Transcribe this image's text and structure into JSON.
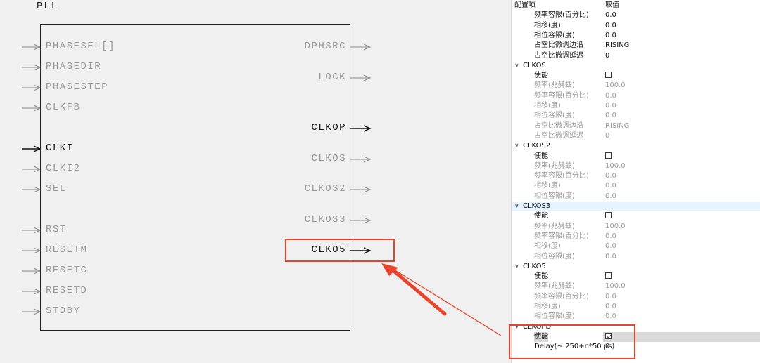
{
  "schematic": {
    "title": "PLL",
    "inputs": [
      {
        "label": "PHASESEL[]",
        "active": false
      },
      {
        "label": "PHASEDIR",
        "active": false
      },
      {
        "label": "PHASESTEP",
        "active": false
      },
      {
        "label": "CLKFB",
        "active": false
      },
      {
        "label": "CLKI",
        "active": true
      },
      {
        "label": "CLKI2",
        "active": false
      },
      {
        "label": "SEL",
        "active": false
      },
      {
        "label": "RST",
        "active": false
      },
      {
        "label": "RESETM",
        "active": false
      },
      {
        "label": "RESETC",
        "active": false
      },
      {
        "label": "RESETD",
        "active": false
      },
      {
        "label": "STDBY",
        "active": false
      }
    ],
    "outputs": [
      {
        "label": "DPHSRC",
        "active": false
      },
      {
        "label": "LOCK",
        "active": false
      },
      {
        "label": "CLKOP",
        "active": true
      },
      {
        "label": "CLKOS",
        "active": false
      },
      {
        "label": "CLKOS2",
        "active": false
      },
      {
        "label": "CLKOS3",
        "active": false
      },
      {
        "label": "CLKO5",
        "active": true
      }
    ],
    "highlight_color": "#e8442b"
  },
  "panel": {
    "header": {
      "key": "配置项",
      "value": "取值"
    },
    "top_rows": [
      {
        "key": "频率容限(百分比)",
        "value": "0.0"
      },
      {
        "key": "相移(度)",
        "value": "0.0"
      },
      {
        "key": "相位容限(度)",
        "value": "0.0"
      },
      {
        "key": "占空比微调边沿",
        "value": "RISING"
      },
      {
        "key": "占空比微调延迟",
        "value": "0"
      }
    ],
    "groups": [
      {
        "name": "CLKOS",
        "rows": [
          {
            "key": "使能",
            "checkbox": true,
            "checked": false
          },
          {
            "key": "频率(兆赫兹)",
            "value": "100.0"
          },
          {
            "key": "频率容限(百分比)",
            "value": "0.0"
          },
          {
            "key": "相移(度)",
            "value": "0.0"
          },
          {
            "key": "相位容限(度)",
            "value": "0.0"
          },
          {
            "key": "占空比微调边沿",
            "value": "RISING"
          },
          {
            "key": "占空比微调延迟",
            "value": "0"
          }
        ]
      },
      {
        "name": "CLKOS2",
        "rows": [
          {
            "key": "使能",
            "checkbox": true,
            "checked": false
          },
          {
            "key": "频率(兆赫兹)",
            "value": "100.0"
          },
          {
            "key": "频率容限(百分比)",
            "value": "0.0"
          },
          {
            "key": "相移(度)",
            "value": "0.0"
          },
          {
            "key": "相位容限(度)",
            "value": "0.0"
          }
        ]
      },
      {
        "name": "CLKOS3",
        "highlighted": true,
        "rows": [
          {
            "key": "使能",
            "checkbox": true,
            "checked": false
          },
          {
            "key": "频率(兆赫兹)",
            "value": "100.0"
          },
          {
            "key": "频率容限(百分比)",
            "value": "0.0"
          },
          {
            "key": "相移(度)",
            "value": "0.0"
          },
          {
            "key": "相位容限(度)",
            "value": "0.0"
          }
        ]
      },
      {
        "name": "CLKO5",
        "rows": [
          {
            "key": "使能",
            "checkbox": true,
            "checked": false
          },
          {
            "key": "频率(兆赫兹)",
            "value": "100.0"
          },
          {
            "key": "频率容限(百分比)",
            "value": "0.0"
          },
          {
            "key": "相移(度)",
            "value": "0.0"
          },
          {
            "key": "相位容限(度)",
            "value": "0.0"
          }
        ]
      },
      {
        "name": "CLKOPD",
        "enabled": true,
        "rows": [
          {
            "key": "使能",
            "checkbox": true,
            "checked": true,
            "selected": true
          },
          {
            "key": "Delay(~ 250+n*50 ps)",
            "value": "0"
          }
        ]
      }
    ]
  }
}
